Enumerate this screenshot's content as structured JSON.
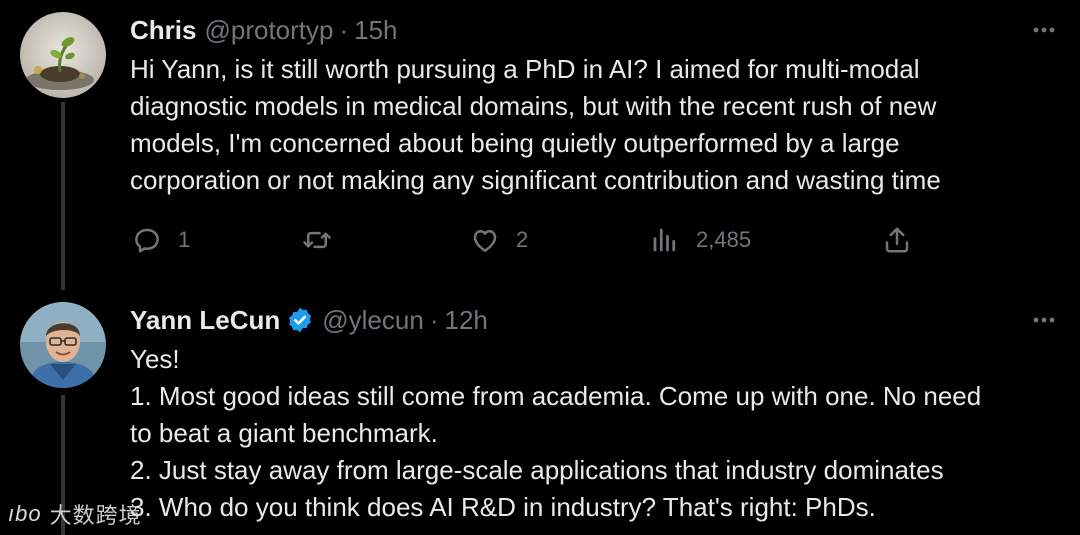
{
  "tweets": [
    {
      "author": {
        "name": "Chris",
        "handle": "@protortyp",
        "separator": "·",
        "time": "15h"
      },
      "body_lines": [
        "Hi Yann, is it still worth pursuing a PhD in AI? I aimed for multi-modal",
        "diagnostic models in medical domains, but with the recent rush of new",
        "models, I'm concerned about being quietly outperformed by a large",
        "corporation or not making any significant contribution and wasting time"
      ],
      "actions": {
        "replies": "1",
        "retweets": "",
        "likes": "2",
        "views": "2,485"
      },
      "more_icon": "more-horizontal-icon",
      "avatar_icon": "avatar-plant-image"
    },
    {
      "author": {
        "name": "Yann LeCun",
        "handle": "@ylecun",
        "separator": "·",
        "time": "12h",
        "verified": true
      },
      "body_lines": [
        "Yes!",
        "1. Most good ideas still come from academia. Come up with one. No need",
        "to beat a giant benchmark.",
        "2. Just stay away from large-scale applications that industry dominates",
        "3. Who do you think does AI R&D in industry? That's right: PhDs."
      ],
      "more_icon": "more-horizontal-icon",
      "avatar_icon": "avatar-portrait-image"
    }
  ],
  "watermark": {
    "logo": "ıbo",
    "text": "大数跨境"
  },
  "colors": {
    "background": "#000000",
    "text": "#e7e9ea",
    "muted": "#71767b",
    "verified": "#1d9bf0",
    "thread_line": "#333639"
  }
}
